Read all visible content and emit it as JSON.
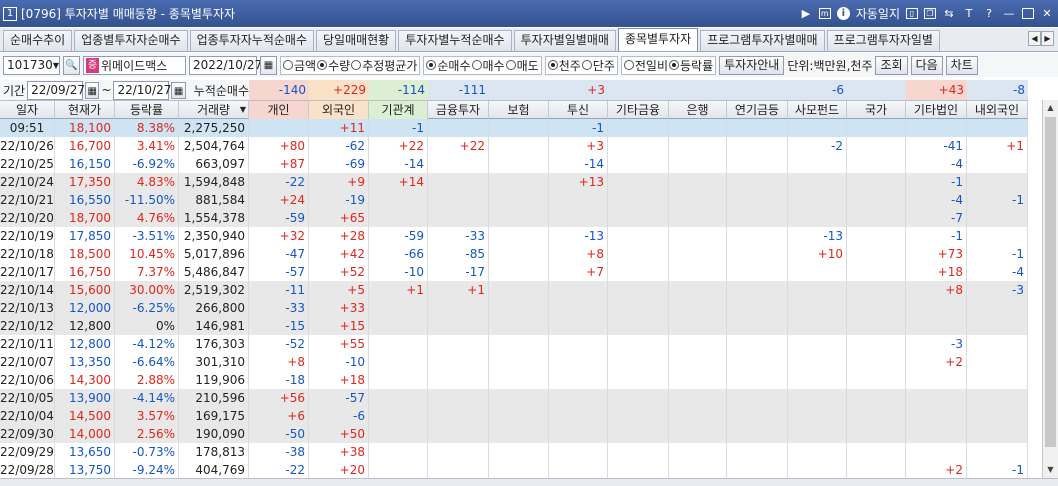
{
  "window": {
    "screen_no": "1",
    "title": "[0796] 투자자별 매매동향 - 종목별투자자",
    "auto_lock": "자동일지",
    "icon_T": "T",
    "icon_help": "?"
  },
  "tabs": [
    {
      "label": "순매수추이",
      "active": false
    },
    {
      "label": "업종별투자자순매수",
      "active": false
    },
    {
      "label": "업종투자자누적순매수",
      "active": false
    },
    {
      "label": "당일매매현황",
      "active": false
    },
    {
      "label": "투자자별누적순매수",
      "active": false
    },
    {
      "label": "투자자별일별매매",
      "active": false
    },
    {
      "label": "종목별투자자",
      "active": true
    },
    {
      "label": "프로그램투자자별매매",
      "active": false
    },
    {
      "label": "프로그램투자자일별",
      "active": false
    }
  ],
  "toolbar": {
    "code": "101730",
    "stock_badge": "증",
    "stock_name": "위메이드맥스",
    "date": "2022/10/27",
    "radio_amount": "금액",
    "radio_qty": "수량",
    "radio_avg": "추정평균가",
    "radio_net": "순매수",
    "radio_buy": "매수",
    "radio_sell": "매도",
    "radio_thousand": "천주",
    "radio_share": "단주",
    "radio_prev": "전일비",
    "radio_rate": "등락률",
    "guide_btn": "투자자안내",
    "unit": "단위:백만원,천주",
    "query_btn": "조회",
    "next_btn": "다음",
    "chart_btn": "차트"
  },
  "period": {
    "label": "기간",
    "from": "22/09/27",
    "to": "22/10/27",
    "tilde": "~",
    "cum_label": "누적순매수"
  },
  "cumulative": [
    "-140",
    "+229",
    "-114",
    "-111",
    "",
    "+3",
    "",
    "",
    "",
    "-6",
    "",
    "+43",
    "-8"
  ],
  "columns": [
    "일자",
    "현재가",
    "등락률",
    "거래량",
    "개인",
    "외국인",
    "기관계",
    "금융투자",
    "보험",
    "투신",
    "기타금융",
    "은행",
    "연기금등",
    "사모펀드",
    "국가",
    "기타법인",
    "내외국인"
  ],
  "rows": [
    {
      "date": "09:51",
      "price": "18,100",
      "rate": "8.38%",
      "volume": "2,275,250",
      "vals": [
        "",
        "+11",
        "-1",
        "",
        "",
        "-1",
        "",
        "",
        "",
        "",
        "",
        "",
        ""
      ],
      "dir": "up",
      "today": true
    },
    {
      "date": "22/10/26",
      "price": "16,700",
      "rate": "3.41%",
      "volume": "2,504,764",
      "vals": [
        "+80",
        "-62",
        "+22",
        "+22",
        "",
        "+3",
        "",
        "",
        "",
        "-2",
        "",
        "-41",
        "+1"
      ],
      "dir": "up"
    },
    {
      "date": "22/10/25",
      "price": "16,150",
      "rate": "-6.92%",
      "volume": "663,097",
      "vals": [
        "+87",
        "-69",
        "-14",
        "",
        "",
        "-14",
        "",
        "",
        "",
        "",
        "",
        "-4",
        ""
      ],
      "dir": "dn"
    },
    {
      "date": "22/10/24",
      "price": "17,350",
      "rate": "4.83%",
      "volume": "1,594,848",
      "vals": [
        "-22",
        "+9",
        "+14",
        "",
        "",
        "+13",
        "",
        "",
        "",
        "",
        "",
        "-1",
        ""
      ],
      "dir": "up"
    },
    {
      "date": "22/10/21",
      "price": "16,550",
      "rate": "-11.50%",
      "volume": "881,584",
      "vals": [
        "+24",
        "-19",
        "",
        "",
        "",
        "",
        "",
        "",
        "",
        "",
        "",
        "-4",
        "-1"
      ],
      "dir": "dn"
    },
    {
      "date": "22/10/20",
      "price": "18,700",
      "rate": "4.76%",
      "volume": "1,554,378",
      "vals": [
        "-59",
        "+65",
        "",
        "",
        "",
        "",
        "",
        "",
        "",
        "",
        "",
        "-7",
        ""
      ],
      "dir": "up"
    },
    {
      "date": "22/10/19",
      "price": "17,850",
      "rate": "-3.51%",
      "volume": "2,350,940",
      "vals": [
        "+32",
        "+28",
        "-59",
        "-33",
        "",
        "-13",
        "",
        "",
        "",
        "-13",
        "",
        "-1",
        ""
      ],
      "dir": "dn"
    },
    {
      "date": "22/10/18",
      "price": "18,500",
      "rate": "10.45%",
      "volume": "5,017,896",
      "vals": [
        "-47",
        "+42",
        "-66",
        "-85",
        "",
        "+8",
        "",
        "",
        "",
        "+10",
        "",
        "+73",
        "-1"
      ],
      "dir": "up"
    },
    {
      "date": "22/10/17",
      "price": "16,750",
      "rate": "7.37%",
      "volume": "5,486,847",
      "vals": [
        "-57",
        "+52",
        "-10",
        "-17",
        "",
        "+7",
        "",
        "",
        "",
        "",
        "",
        "+18",
        "-4"
      ],
      "dir": "up"
    },
    {
      "date": "22/10/14",
      "price": "15,600",
      "rate": "30.00%",
      "volume": "2,519,302",
      "vals": [
        "-11",
        "+5",
        "+1",
        "+1",
        "",
        "",
        "",
        "",
        "",
        "",
        "",
        "+8",
        "-3"
      ],
      "dir": "up"
    },
    {
      "date": "22/10/13",
      "price": "12,000",
      "rate": "-6.25%",
      "volume": "266,800",
      "vals": [
        "-33",
        "+33",
        "",
        "",
        "",
        "",
        "",
        "",
        "",
        "",
        "",
        "",
        ""
      ],
      "dir": "dn"
    },
    {
      "date": "22/10/12",
      "price": "12,800",
      "rate": "0%",
      "volume": "146,981",
      "vals": [
        "-15",
        "+15",
        "",
        "",
        "",
        "",
        "",
        "",
        "",
        "",
        "",
        "",
        ""
      ],
      "dir": "nt"
    },
    {
      "date": "22/10/11",
      "price": "12,800",
      "rate": "-4.12%",
      "volume": "176,303",
      "vals": [
        "-52",
        "+55",
        "",
        "",
        "",
        "",
        "",
        "",
        "",
        "",
        "",
        "-3",
        ""
      ],
      "dir": "dn"
    },
    {
      "date": "22/10/07",
      "price": "13,350",
      "rate": "-6.64%",
      "volume": "301,310",
      "vals": [
        "+8",
        "-10",
        "",
        "",
        "",
        "",
        "",
        "",
        "",
        "",
        "",
        "+2",
        ""
      ],
      "dir": "dn"
    },
    {
      "date": "22/10/06",
      "price": "14,300",
      "rate": "2.88%",
      "volume": "119,906",
      "vals": [
        "-18",
        "+18",
        "",
        "",
        "",
        "",
        "",
        "",
        "",
        "",
        "",
        "",
        ""
      ],
      "dir": "up"
    },
    {
      "date": "22/10/05",
      "price": "13,900",
      "rate": "-4.14%",
      "volume": "210,596",
      "vals": [
        "+56",
        "-57",
        "",
        "",
        "",
        "",
        "",
        "",
        "",
        "",
        "",
        "",
        ""
      ],
      "dir": "dn"
    },
    {
      "date": "22/10/04",
      "price": "14,500",
      "rate": "3.57%",
      "volume": "169,175",
      "vals": [
        "+6",
        "-6",
        "",
        "",
        "",
        "",
        "",
        "",
        "",
        "",
        "",
        "",
        ""
      ],
      "dir": "up"
    },
    {
      "date": "22/09/30",
      "price": "14,000",
      "rate": "2.56%",
      "volume": "190,090",
      "vals": [
        "-50",
        "+50",
        "",
        "",
        "",
        "",
        "",
        "",
        "",
        "",
        "",
        "",
        ""
      ],
      "dir": "up"
    },
    {
      "date": "22/09/29",
      "price": "13,650",
      "rate": "-0.73%",
      "volume": "178,813",
      "vals": [
        "-38",
        "+38",
        "",
        "",
        "",
        "",
        "",
        "",
        "",
        "",
        "",
        "",
        ""
      ],
      "dir": "dn"
    },
    {
      "date": "22/09/28",
      "price": "13,750",
      "rate": "-9.24%",
      "volume": "404,769",
      "vals": [
        "-22",
        "+20",
        "",
        "",
        "",
        "",
        "",
        "",
        "",
        "",
        "",
        "+2",
        "-1"
      ],
      "dir": "dn"
    }
  ],
  "colors": {
    "up": "#e1261c",
    "down": "#1455c8",
    "title_bar": "#3b5998",
    "today_row": "#cfe4f3"
  }
}
